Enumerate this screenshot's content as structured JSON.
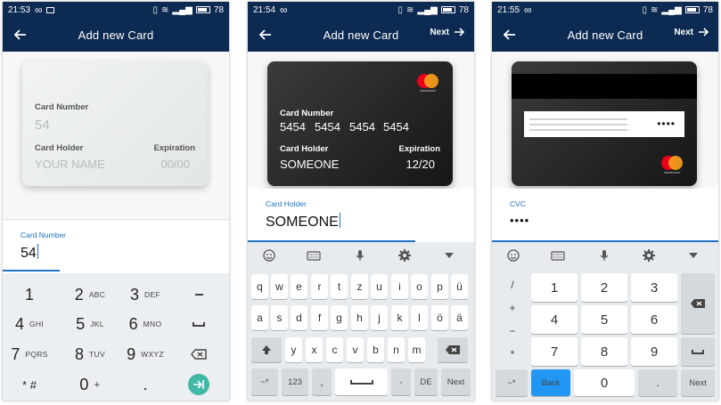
{
  "colors": {
    "appbar": "#0d2a52",
    "accent": "#1f73c4",
    "go_button": "#3fb8a6",
    "back_key": "#2196f3"
  },
  "screens": [
    {
      "status": {
        "time": "21:53",
        "battery": "78"
      },
      "appbar": {
        "title": "Add new Card"
      },
      "card": {
        "number_label": "Card Number",
        "number_value": "54",
        "holder_label": "Card Holder",
        "holder_value": "YOUR NAME",
        "expiration_label": "Expiration",
        "expiration_value": "00/00"
      },
      "field": {
        "label": "Card Number",
        "value": "54"
      },
      "numpad": {
        "rows": [
          [
            {
              "d": "1",
              "s": ""
            },
            {
              "d": "2",
              "s": "ABC"
            },
            {
              "d": "3",
              "s": "DEF"
            },
            {
              "icon": "minus-icon"
            }
          ],
          [
            {
              "d": "4",
              "s": "GHI"
            },
            {
              "d": "5",
              "s": "JKL"
            },
            {
              "d": "6",
              "s": "MNO"
            },
            {
              "icon": "space-icon"
            }
          ],
          [
            {
              "d": "7",
              "s": "PQRS"
            },
            {
              "d": "8",
              "s": "TUV"
            },
            {
              "d": "9",
              "s": "WXYZ"
            },
            {
              "icon": "backspace-icon"
            }
          ],
          [
            {
              "d": "* #",
              "s": ""
            },
            {
              "d": "0",
              "s": "+"
            },
            {
              "d": ".",
              "s": ""
            },
            {
              "icon": "go-icon"
            }
          ]
        ]
      }
    },
    {
      "status": {
        "time": "21:54",
        "battery": "78"
      },
      "appbar": {
        "title": "Add new Card",
        "next": "Next"
      },
      "card": {
        "brand": "mastercard",
        "number_label": "Card Number",
        "number_groups": [
          "5454",
          "5454",
          "5454",
          "5454"
        ],
        "holder_label": "Card Holder",
        "holder_value": "SOMEONE",
        "expiration_label": "Expiration",
        "expiration_value": "12/20"
      },
      "field": {
        "label": "Card Holder",
        "value": "SOMEONE"
      },
      "keyboard": {
        "toolbar_icons": [
          "emoji-icon",
          "keyboard-icon",
          "mic-icon",
          "settings-icon",
          "collapse-icon"
        ],
        "row1": [
          "q",
          "w",
          "e",
          "r",
          "t",
          "z",
          "u",
          "i",
          "o",
          "p",
          "ü"
        ],
        "row2": [
          "a",
          "s",
          "d",
          "f",
          "g",
          "h",
          "j",
          "k",
          "l",
          "ö",
          "ä"
        ],
        "row3": [
          "y",
          "x",
          "c",
          "v",
          "b",
          "n",
          "m"
        ],
        "symbols": "~*",
        "numbers": "123",
        "comma": ",",
        "period": "·",
        "language": "DE",
        "next": "Next"
      }
    },
    {
      "status": {
        "time": "21:55",
        "battery": "78"
      },
      "appbar": {
        "title": "Add new Card",
        "next": "Next"
      },
      "card": {
        "brand": "mastercard",
        "cvc_masked": "••••"
      },
      "field": {
        "label": "CVC",
        "value": "••••"
      },
      "keyboard": {
        "toolbar_icons": [
          "emoji-icon",
          "keyboard-icon",
          "mic-icon",
          "settings-icon",
          "collapse-icon"
        ],
        "operators": [
          "/",
          "+",
          "−",
          "*"
        ],
        "digits": [
          [
            "1",
            "2",
            "3"
          ],
          [
            "4",
            "5",
            "6"
          ],
          [
            "7",
            "8",
            "9"
          ]
        ],
        "symbols": "~*",
        "back": "Back",
        "zero": "0",
        "dot": ".",
        "next": "Next"
      }
    }
  ]
}
